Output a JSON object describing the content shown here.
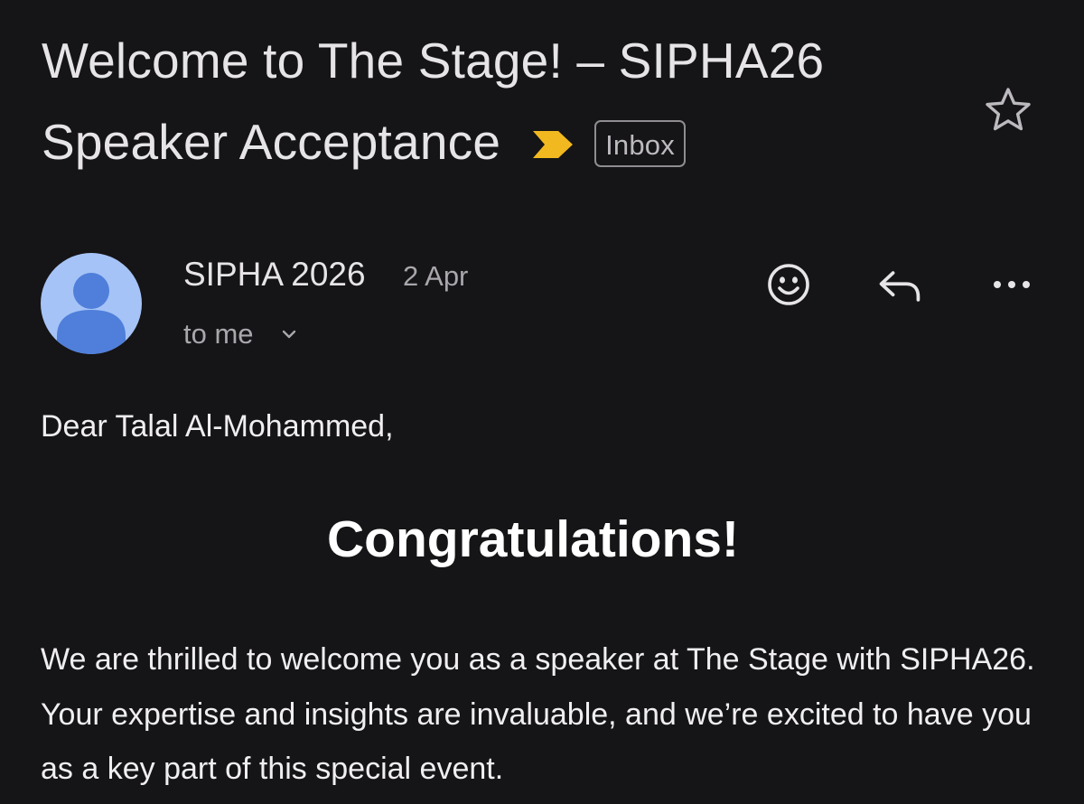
{
  "email": {
    "subject_line1": "Welcome to The Stage! – SIPHA26",
    "subject_line2": "Speaker Acceptance",
    "label": "Inbox",
    "important_color": "#f2b81f",
    "sender": {
      "name": "SIPHA 2026",
      "date": "2 Apr",
      "recipient": "to me",
      "avatar_color": "#a6c3f7"
    },
    "actions": {
      "star_icon": "star-outline-icon",
      "emoji_icon": "emoji-reaction-icon",
      "reply_icon": "reply-icon",
      "more_icon": "more-horizontal-icon"
    },
    "body": {
      "greeting": "Dear Talal Al-Mohammed,",
      "headline": "Congratulations!",
      "paragraph": "We are thrilled to welcome you as a speaker at The Stage with SIPHA26. Your expertise and insights are invaluable, and we’re excited to have you as a key part of this special event."
    }
  }
}
